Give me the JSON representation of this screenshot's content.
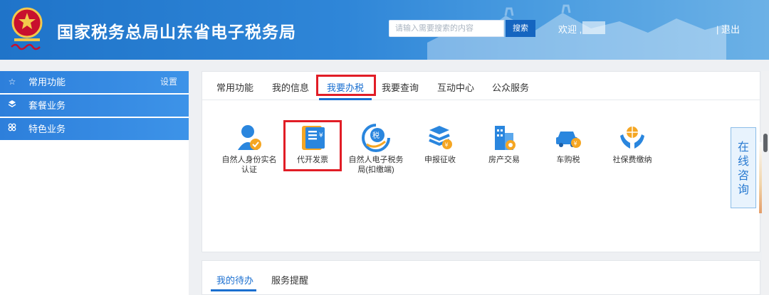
{
  "header": {
    "title": "国家税务总局山东省电子税务局",
    "search_placeholder": "请输入需要搜索的内容",
    "search_button": "搜索",
    "welcome": "欢迎 ,",
    "logout": "| 退出",
    "emblem_icon": "tax-emblem-icon",
    "colors": {
      "primary": "#2f86d8",
      "search_button": "#1565c0"
    }
  },
  "sidebar": {
    "items": [
      {
        "label": "常用功能",
        "icon": "star-icon",
        "extra": "设置"
      },
      {
        "label": "套餐业务",
        "icon": "layers-icon"
      },
      {
        "label": "特色业务",
        "icon": "cluster-icon"
      }
    ]
  },
  "main": {
    "tabs": [
      {
        "label": "常用功能"
      },
      {
        "label": "我的信息"
      },
      {
        "label": "我要办税",
        "active": true
      },
      {
        "label": "我要查询"
      },
      {
        "label": "互动中心"
      },
      {
        "label": "公众服务"
      }
    ],
    "icons": [
      {
        "label": "自然人身份实名认证",
        "icon": "person-verify-icon"
      },
      {
        "label": "代开发票",
        "icon": "invoice-icon",
        "highlighted": true
      },
      {
        "label": "自然人电子税务局(扣缴端)",
        "icon": "tax-badge-icon"
      },
      {
        "label": "申报征收",
        "icon": "stack-coin-icon"
      },
      {
        "label": "房产交易",
        "icon": "building-icon"
      },
      {
        "label": "车购税",
        "icon": "car-tax-icon"
      },
      {
        "label": "社保费缴纳",
        "icon": "hands-globe-icon"
      }
    ]
  },
  "consult": {
    "label": "在线咨询"
  },
  "bottom": {
    "tabs": [
      {
        "label": "我的待办",
        "active": true
      },
      {
        "label": "服务提醒"
      }
    ]
  },
  "highlight_color": "#e11d26"
}
